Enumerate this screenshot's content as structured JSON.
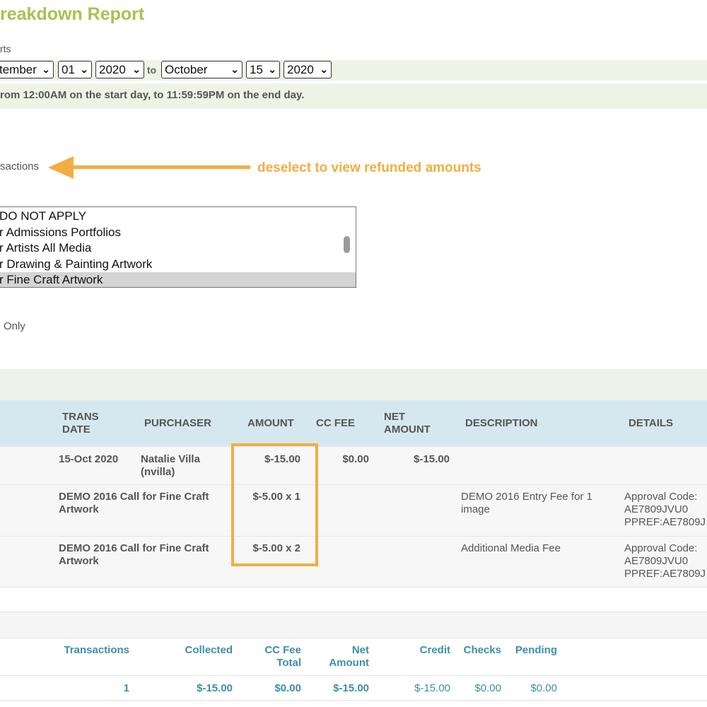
{
  "page": {
    "title": "reakdown Report",
    "filter_label": "rts"
  },
  "date_range": {
    "start_month": "tember",
    "start_day": "01",
    "start_year": "2020",
    "to_label": "to",
    "end_month": "October",
    "end_day": "15",
    "end_year": "2020",
    "note": "rom 12:00AM on the start day, to 11:59:59PM on the end day."
  },
  "filters": {
    "transactions_label": "sactions",
    "annotation": "deselect to view refunded amounts",
    "list_options": [
      "DO NOT APPLY",
      "r Admissions Portfolios",
      "r Artists All Media",
      "r Drawing & Painting Artwork",
      "r Fine Craft Artwork"
    ],
    "selected_option_index": 4,
    "only_label": "Only"
  },
  "table": {
    "headers": {
      "trans_date_1": "TRANS",
      "trans_date_2": "DATE",
      "purchaser": "PURCHASER",
      "amount": "AMOUNT",
      "cc_fee": "CC FEE",
      "net_amount_1": "NET",
      "net_amount_2": "AMOUNT",
      "description": "DESCRIPTION",
      "details": "DETAILS"
    },
    "transaction": {
      "date": "15-Oct 2020",
      "purchaser_name": "Natalie Villa",
      "purchaser_user": "(nvilla)",
      "amount": "$-15.00",
      "cc_fee": "$0.00",
      "net_amount": "$-15.00"
    },
    "items": [
      {
        "item_1": "DEMO 2016 Call for Fine Craft",
        "item_2": "Artwork",
        "amount": "$-5.00 x 1",
        "description_1": "DEMO 2016 Entry Fee for 1",
        "description_2": "image",
        "details_1": "Approval Code:",
        "details_2": "AE7809JVU0",
        "details_3": "PPREF:AE7809J"
      },
      {
        "item_1": "DEMO 2016 Call for Fine Craft",
        "item_2": "Artwork",
        "amount": "$-5.00 x 2",
        "description_1": "Additional Media Fee",
        "description_2": "",
        "details_1": "Approval Code:",
        "details_2": "AE7809JVU0",
        "details_3": "PPREF:AE7809J"
      }
    ]
  },
  "summary": {
    "headers": {
      "transactions": "Transactions",
      "collected": "Collected",
      "cc_fee_1": "CC Fee",
      "cc_fee_2": "Total",
      "net_1": "Net",
      "net_2": "Amount",
      "credit": "Credit",
      "checks": "Checks",
      "pending": "Pending"
    },
    "values": {
      "transactions": "1",
      "collected": "$-15.00",
      "cc_fee_total": "$0.00",
      "net_amount": "$-15.00",
      "credit": "$-15.00",
      "checks": "$0.00",
      "pending": "$0.00"
    }
  },
  "colors": {
    "title_green": "#a4c34f",
    "annotation_orange": "#f2ae42",
    "header_blue_bg": "#d6e8ef",
    "summary_blue_text": "#3d8eaa",
    "band_green": "#eef3e6"
  },
  "icons": {
    "dropdown": "chevron-down-icon",
    "annotation_arrow": "arrow-left-icon"
  }
}
